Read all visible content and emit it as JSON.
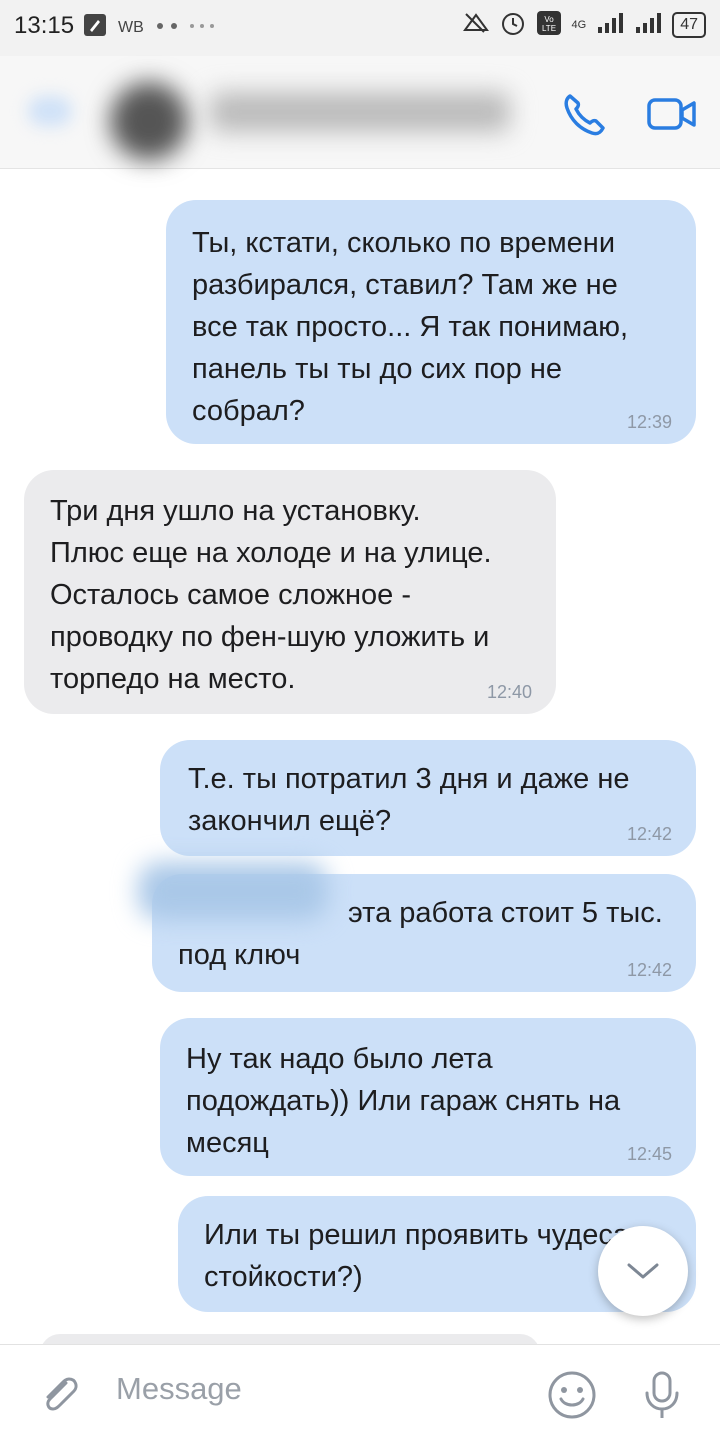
{
  "status_bar": {
    "time": "13:15",
    "carrier_label": "WB",
    "network": "4G",
    "battery": "47",
    "icons": [
      "pencil-icon",
      "dots-icon",
      "alarm-icon",
      "clock-icon",
      "volte-icon",
      "signal-icon",
      "signal-icon",
      "battery-icon"
    ]
  },
  "header": {
    "icons": [
      "back-icon",
      "avatar",
      "phone-icon",
      "video-icon"
    ]
  },
  "messages": [
    {
      "direction": "out",
      "text": "Ты, кстати, сколько по времени\nразбирался, ставил? Там же не\nвсе так просто... Я так понимаю,\nпанель ты ты до сих пор не\nсобрал?",
      "time": "12:39"
    },
    {
      "direction": "in",
      "text": "Три дня ушло на установку.\nПлюс еще на холоде и на улице.\nОсталось самое сложное -\nпроводку по фен-шую уложить и\nторпедо на место.",
      "time": "12:40"
    },
    {
      "direction": "out",
      "text": "Т.е. ты потратил 3 дня и даже не\nзакончил ещё?",
      "time": "12:42"
    },
    {
      "direction": "out",
      "text": "эта работа стоит 5 тыс.\nпод ключ",
      "time": "12:42"
    },
    {
      "direction": "out",
      "text": "Ну так надо было лета\nподождать)) Или гараж снять на\nмесяц",
      "time": "12:45"
    },
    {
      "direction": "out",
      "text": "Или ты решил проявить чудеса\nстойкости?)",
      "time": ""
    }
  ],
  "composer": {
    "placeholder": "Message",
    "icons": [
      "attach-icon",
      "emoji-icon",
      "mic-icon"
    ]
  },
  "colors": {
    "outgoing_bubble": "#cce0f8",
    "incoming_bubble": "#ebebed",
    "accent": "#2a7de1"
  }
}
